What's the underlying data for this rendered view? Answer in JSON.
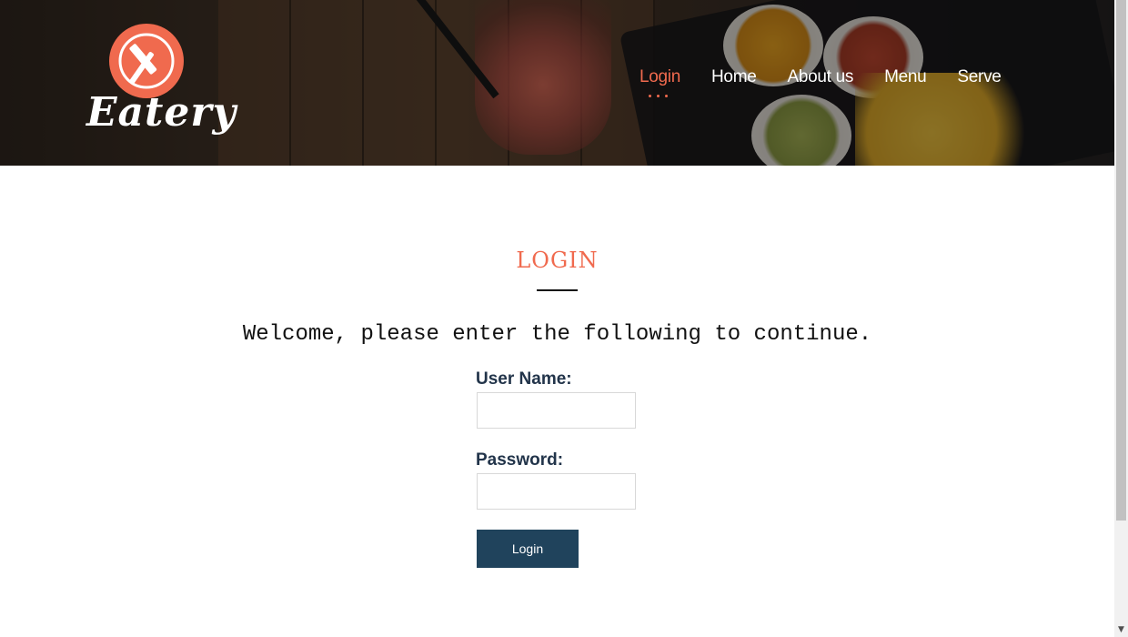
{
  "brand": {
    "name": "Eatery",
    "accent": "#f06a4e"
  },
  "nav": {
    "items": [
      {
        "label": "Login",
        "active": true
      },
      {
        "label": "Home",
        "active": false
      },
      {
        "label": "About us",
        "active": false
      },
      {
        "label": "Menu",
        "active": false
      },
      {
        "label": "Serve",
        "active": false
      }
    ]
  },
  "main": {
    "title": "LOGIN",
    "welcome": "Welcome, please enter the following to continue.",
    "form": {
      "username_label": "User Name:",
      "username_value": "",
      "password_label": "Password:",
      "password_value": "",
      "submit_label": "Login",
      "button_color": "#20435c"
    }
  }
}
